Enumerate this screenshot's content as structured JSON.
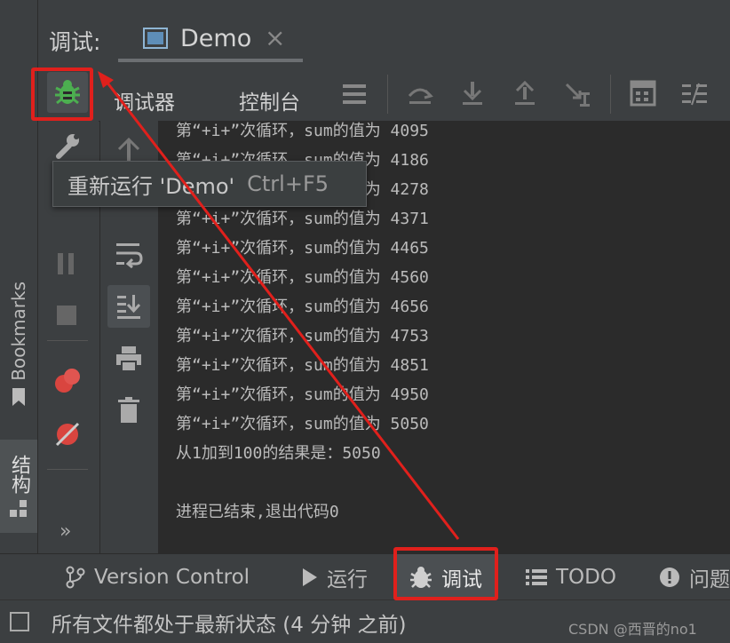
{
  "header": {
    "debug_label": "调试:",
    "tab_name": "Demo",
    "tab_close": "×"
  },
  "toolbar": {
    "tab_debugger": "调试器",
    "tab_console": "控制台"
  },
  "tooltip": {
    "text": "重新运行 'Demo'",
    "shortcut": "Ctrl+F5"
  },
  "console": {
    "lines": [
      "第“+i+”次循环，sum的值为 4095",
      "第“+i+”次循环，sum的值为 4186",
      "第“+i+”次循环，sum的值为 4278",
      "第“+i+”次循环，sum的值为 4371",
      "第“+i+”次循环，sum的值为 4465",
      "第“+i+”次循环，sum的值为 4560",
      "第“+i+”次循环，sum的值为 4656",
      "第“+i+”次循环，sum的值为 4753",
      "第“+i+”次循环，sum的值为 4851",
      "第“+i+”次循环，sum的值为 4950",
      "第“+i+”次循环，sum的值为 5050",
      "从1加到100的结果是：5050",
      "",
      "进程已结束,退出代码0"
    ]
  },
  "side": {
    "bookmarks": "Bookmarks",
    "structure": "结构",
    "more": "»"
  },
  "bottom_tabs": {
    "version_control": "Version Control",
    "run": "运行",
    "debug": "调试",
    "todo": "TODO",
    "problems": "问题"
  },
  "status": {
    "text": "所有文件都处于最新状态 (4 分钟 之前)",
    "watermark": "CSDN @西晋的no1"
  },
  "colors": {
    "accent_red": "#e0201c",
    "bug_green": "#4caf50",
    "panel": "#3c3f41",
    "console_bg": "#2b2b2b"
  }
}
